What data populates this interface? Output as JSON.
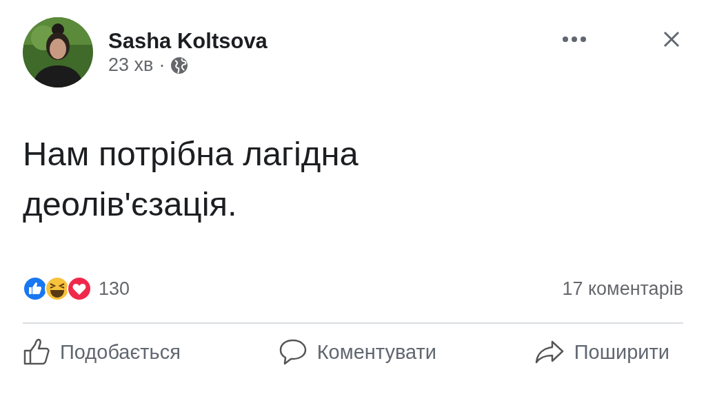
{
  "post": {
    "author": "Sasha Koltsova",
    "time": "23 хв",
    "separator": "·",
    "text": "Нам потрібна лагідна деолів'єзація."
  },
  "reactions": {
    "count": "130",
    "comments": "17 коментарів"
  },
  "actions": [
    {
      "kind": "like",
      "label": "Подобається"
    },
    {
      "kind": "comment",
      "label": "Коментувати"
    },
    {
      "kind": "share",
      "label": "Поширити"
    }
  ]
}
